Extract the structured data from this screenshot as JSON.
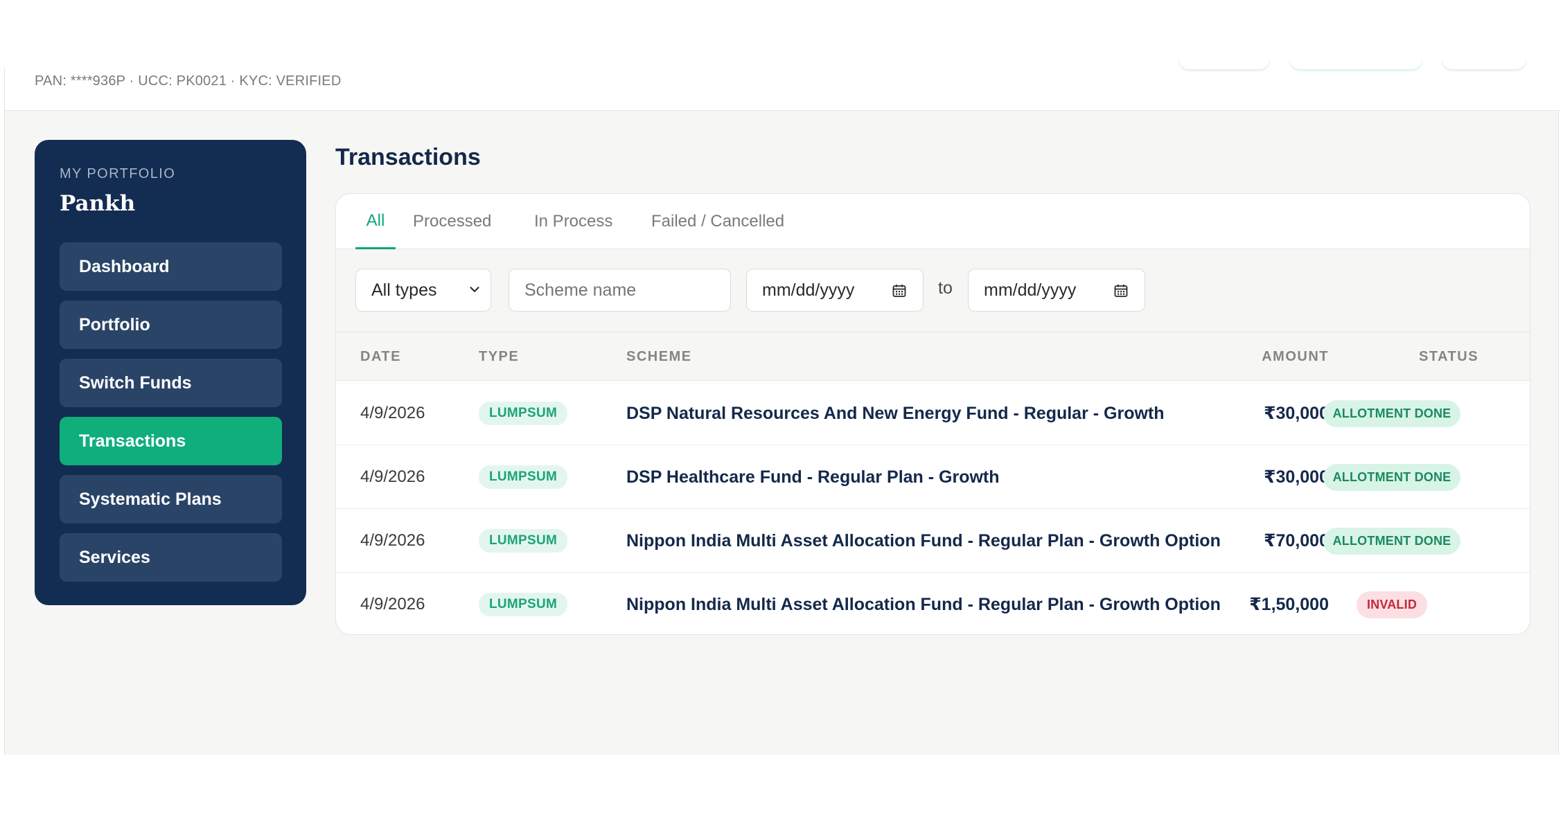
{
  "header": {
    "id_line": "PAN: ****936P · UCC: PK0021 · KYC: VERIFIED"
  },
  "sidebar": {
    "kicker": "MY PORTFOLIO",
    "name": "Pankh",
    "items": [
      {
        "label": "Dashboard",
        "active": false
      },
      {
        "label": "Portfolio",
        "active": false
      },
      {
        "label": "Switch Funds",
        "active": false
      },
      {
        "label": "Transactions",
        "active": true
      },
      {
        "label": "Systematic Plans",
        "active": false
      },
      {
        "label": "Services",
        "active": false
      }
    ]
  },
  "main": {
    "title": "Transactions",
    "tabs": [
      {
        "label": "All",
        "active": true
      },
      {
        "label": "Processed",
        "active": false
      },
      {
        "label": "In Process",
        "active": false
      },
      {
        "label": "Failed / Cancelled",
        "active": false
      }
    ],
    "filters": {
      "type_value": "All types",
      "scheme_placeholder": "Scheme name",
      "date_from": "mm/dd/yyyy",
      "date_to": "mm/dd/yyyy",
      "to_label": "to"
    },
    "columns": [
      "DATE",
      "TYPE",
      "SCHEME",
      "AMOUNT",
      "STATUS"
    ],
    "rows": [
      {
        "date": "4/9/2026",
        "type": "LUMPSUM",
        "scheme": "DSP Natural Resources And New Energy Fund - Regular - Growth",
        "amount": "₹30,000",
        "status": "ALLOTMENT DONE",
        "status_kind": "ok"
      },
      {
        "date": "4/9/2026",
        "type": "LUMPSUM",
        "scheme": "DSP Healthcare Fund - Regular Plan - Growth",
        "amount": "₹30,000",
        "status": "ALLOTMENT DONE",
        "status_kind": "ok"
      },
      {
        "date": "4/9/2026",
        "type": "LUMPSUM",
        "scheme": "Nippon India Multi Asset Allocation Fund - Regular Plan - Growth Option",
        "amount": "₹70,000",
        "status": "ALLOTMENT DONE",
        "status_kind": "ok"
      },
      {
        "date": "4/9/2026",
        "type": "LUMPSUM",
        "scheme": "Nippon India Multi Asset Allocation Fund - Regular Plan - Growth Option",
        "amount": "₹1,50,000",
        "status": "INVALID",
        "status_kind": "bad"
      }
    ]
  },
  "colors": {
    "navy": "#132c52",
    "accent_green": "#0fae7b",
    "ok_badge_bg": "#d8f4e7",
    "bad_badge_bg": "#fcdfe2"
  }
}
